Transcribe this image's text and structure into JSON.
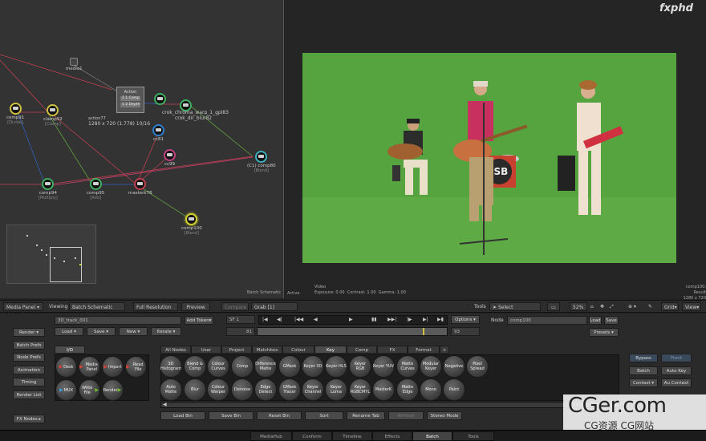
{
  "logo": "fxphd",
  "schematic": {
    "label": "Batch Schematic",
    "nodes": [
      {
        "label": "media1",
        "sub": ""
      },
      {
        "label": "comp91",
        "sub": "[Divide]"
      },
      {
        "label": "clamp92",
        "sub": "[Clamp]"
      },
      {
        "label": "Action",
        "sub": ""
      },
      {
        "label": "action77",
        "sub": "1280 x 720 (1.778) 10/16"
      },
      {
        "label": "crok_chroma_warp_1_gpl83",
        "sub": ""
      },
      {
        "label": "crok_dir_blur82",
        "sub": ""
      },
      {
        "label": "cc81",
        "sub": ""
      },
      {
        "label": "cc99",
        "sub": ""
      },
      {
        "label": "(C1) comp80",
        "sub": "[Blend]"
      },
      {
        "label": "comp94",
        "sub": "[Multiply]"
      },
      {
        "label": "comp95",
        "sub": "[Add]"
      },
      {
        "label": "masterk78",
        "sub": ""
      },
      {
        "label": "comp100",
        "sub": "[Blend]"
      }
    ],
    "action_lines": [
      "1 1 Comp",
      "1 2 Depth"
    ]
  },
  "viewer": {
    "active_label": "Active",
    "video_label": "Video",
    "exposure": "Exposure: 0.00",
    "contrast": "Contrast: 1.00",
    "gamma": "Gamma: 1.00",
    "result_line1": "comp100: Result",
    "result_line2": "1280 x 720 (1.778)",
    "image_text": "JSB"
  },
  "toolbar": {
    "media_panel": "Media Panel",
    "viewing_label": "Viewing",
    "viewing_value": "Batch Schematic",
    "full_resolution": "Full Resolution",
    "preview": "Preview",
    "compare": "Compare",
    "grab": "Grab [1]",
    "tools_label": "Tools",
    "select": "Select",
    "zoom": "52%",
    "grid": "Grid",
    "view": "View"
  },
  "left_col": [
    "Render",
    "Batch Prefs",
    "Node Prefs",
    "Animation",
    "Timing",
    "Render List",
    "FX Nodes"
  ],
  "controls": {
    "setup_name": "3D_track_001",
    "add_token": "Add Token",
    "load": "Load",
    "save": "Save",
    "new": "New",
    "iterate": "Iterate",
    "frame": "1",
    "range_start": "81",
    "range_end": "93",
    "options": "Options",
    "node_label": "Node",
    "node_name": "comp100",
    "node_load": "Load",
    "node_save": "Save",
    "presets": "Presets"
  },
  "lib": {
    "tab": "I/O",
    "buttons": [
      {
        "label": "Desk"
      },
      {
        "label": "Media Panel"
      },
      {
        "label": "Import"
      },
      {
        "label": "Read File"
      },
      {
        "label": "MUX"
      },
      {
        "label": "Write File"
      },
      {
        "label": "Render"
      }
    ]
  },
  "fx_tabs": [
    "All Nodes",
    "User",
    "Project",
    "Matchbox",
    "Colour",
    "Key",
    "Comp",
    "FX",
    "Format",
    "+"
  ],
  "fx_row1": [
    "3D Histogram",
    "Blend & Comp",
    "Colour Curves",
    "Comp",
    "Difference Matte",
    "GMask",
    "Keyer 3D",
    "Keyer HLS",
    "Keyer RGB",
    "Keyer YUV",
    "Matte Curves",
    "Modular Keyer",
    "Negative",
    "Pixel Spread"
  ],
  "fx_row2": [
    "Auto Matte",
    "Blur",
    "Colour Warper",
    "Denoise",
    "Edge Detect",
    "GMask Tracer",
    "Keyer Channel",
    "Keyer Luma",
    "Keyer RGBCMYL",
    "MasterK",
    "Matte Edge",
    "Mono",
    "Paint"
  ],
  "bin_buttons": [
    "Load Bin",
    "Save Bin",
    "Reset Bin",
    "Sort",
    "Rename Tab",
    "Refresh",
    "Stereo Mode"
  ],
  "right_col": [
    "Bypass",
    "Front",
    "Batch",
    "Auto Key",
    "Context",
    "Au Context"
  ],
  "bottom_tabs": [
    "MediaHub",
    "Conform",
    "Timeline",
    "Effects",
    "Batch",
    "Tools"
  ],
  "watermark": {
    "line1": "CGer.com",
    "line2": "CG资源 CG网站"
  }
}
